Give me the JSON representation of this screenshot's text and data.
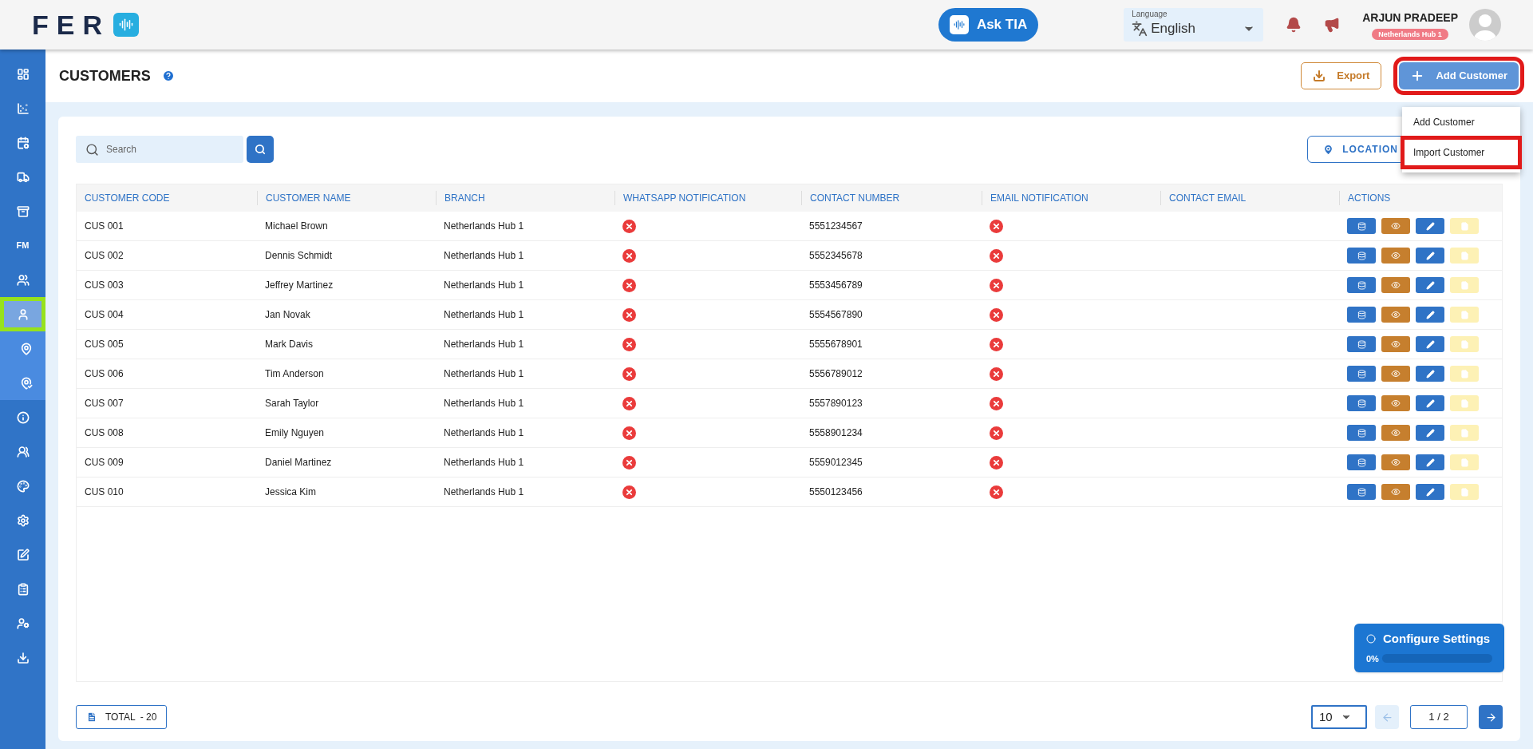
{
  "header": {
    "logo": {
      "text": "FER"
    },
    "ask_button": {
      "label": "Ask TIA"
    },
    "language": {
      "caption": "Language",
      "value": "English"
    },
    "user": {
      "name": "ARJUN PRADEEP",
      "hub": "Netherlands Hub 1"
    }
  },
  "sidebar": {
    "items": [
      {
        "kind": "dashboard",
        "selected": false,
        "highlighted": false
      },
      {
        "kind": "chart",
        "selected": false,
        "highlighted": false
      },
      {
        "kind": "calendar",
        "selected": false,
        "highlighted": false
      },
      {
        "kind": "truck",
        "selected": false,
        "highlighted": false
      },
      {
        "kind": "archive",
        "selected": false,
        "highlighted": false
      },
      {
        "kind": "text",
        "label": "FM",
        "selected": false,
        "highlighted": false
      },
      {
        "kind": "users",
        "selected": false,
        "highlighted": false
      },
      {
        "kind": "user",
        "selected": true,
        "highlighted": true,
        "expanded": true,
        "children": [
          {
            "kind": "pin",
            "selected": false,
            "highlighted": false
          },
          {
            "kind": "pin-check",
            "selected": false,
            "highlighted": false
          }
        ]
      },
      {
        "kind": "info",
        "selected": false,
        "highlighted": false
      },
      {
        "kind": "group",
        "selected": false,
        "highlighted": false
      },
      {
        "kind": "palette",
        "selected": false,
        "highlighted": false
      },
      {
        "kind": "gear",
        "selected": false,
        "highlighted": false
      },
      {
        "kind": "edit",
        "selected": false,
        "highlighted": false
      },
      {
        "kind": "clipboard",
        "selected": false,
        "highlighted": false
      },
      {
        "kind": "user-tie",
        "selected": false,
        "highlighted": false
      },
      {
        "kind": "download",
        "selected": false,
        "highlighted": false
      }
    ]
  },
  "page": {
    "title": "CUSTOMERS",
    "export_button": {
      "label": "Export"
    },
    "add_button": {
      "label": "Add Customer",
      "highlighted": true
    },
    "add_menu": {
      "items": [
        {
          "label": "Add Customer",
          "highlighted": false
        },
        {
          "label": "Import Customer",
          "highlighted": true
        }
      ]
    }
  },
  "search": {
    "placeholder": "Search"
  },
  "location_button": {
    "label": "LOCATION"
  },
  "table": {
    "columns": [
      "CUSTOMER CODE",
      "CUSTOMER NAME",
      "BRANCH",
      "WHATSAPP NOTIFICATION",
      "CONTACT NUMBER",
      "EMAIL NOTIFICATION",
      "CONTACT EMAIL",
      "ACTIONS"
    ],
    "rows": [
      {
        "code": "CUS 001",
        "name": "Michael Brown",
        "branch": "Netherlands Hub 1",
        "whatsapp": false,
        "contact": "5551234567",
        "email_notification": false
      },
      {
        "code": "CUS 002",
        "name": "Dennis Schmidt",
        "branch": "Netherlands Hub 1",
        "whatsapp": false,
        "contact": "5552345678",
        "email_notification": false
      },
      {
        "code": "CUS 003",
        "name": "Jeffrey Martinez",
        "branch": "Netherlands Hub 1",
        "whatsapp": false,
        "contact": "5553456789",
        "email_notification": false
      },
      {
        "code": "CUS 004",
        "name": "Jan Novak",
        "branch": "Netherlands Hub 1",
        "whatsapp": false,
        "contact": "5554567890",
        "email_notification": false
      },
      {
        "code": "CUS 005",
        "name": "Mark Davis",
        "branch": "Netherlands Hub 1",
        "whatsapp": false,
        "contact": "5555678901",
        "email_notification": false
      },
      {
        "code": "CUS 006",
        "name": "Tim Anderson",
        "branch": "Netherlands Hub 1",
        "whatsapp": false,
        "contact": "5556789012",
        "email_notification": false
      },
      {
        "code": "CUS 007",
        "name": "Sarah Taylor",
        "branch": "Netherlands Hub 1",
        "whatsapp": false,
        "contact": "5557890123",
        "email_notification": false
      },
      {
        "code": "CUS 008",
        "name": "Emily Nguyen",
        "branch": "Netherlands Hub 1",
        "whatsapp": false,
        "contact": "5558901234",
        "email_notification": false
      },
      {
        "code": "CUS 009",
        "name": "Daniel Martinez",
        "branch": "Netherlands Hub 1",
        "whatsapp": false,
        "contact": "5559012345",
        "email_notification": false
      },
      {
        "code": "CUS 010",
        "name": "Jessica Kim",
        "branch": "Netherlands Hub 1",
        "whatsapp": false,
        "contact": "5550123456",
        "email_notification": false
      }
    ]
  },
  "footer": {
    "total": "TOTAL  - 20",
    "page_size": "10",
    "prev_disabled": true,
    "page": "1 / 2",
    "next_disabled": false
  },
  "configure_widget": {
    "title": "Configure Settings",
    "percent": "0%",
    "level": 0
  }
}
